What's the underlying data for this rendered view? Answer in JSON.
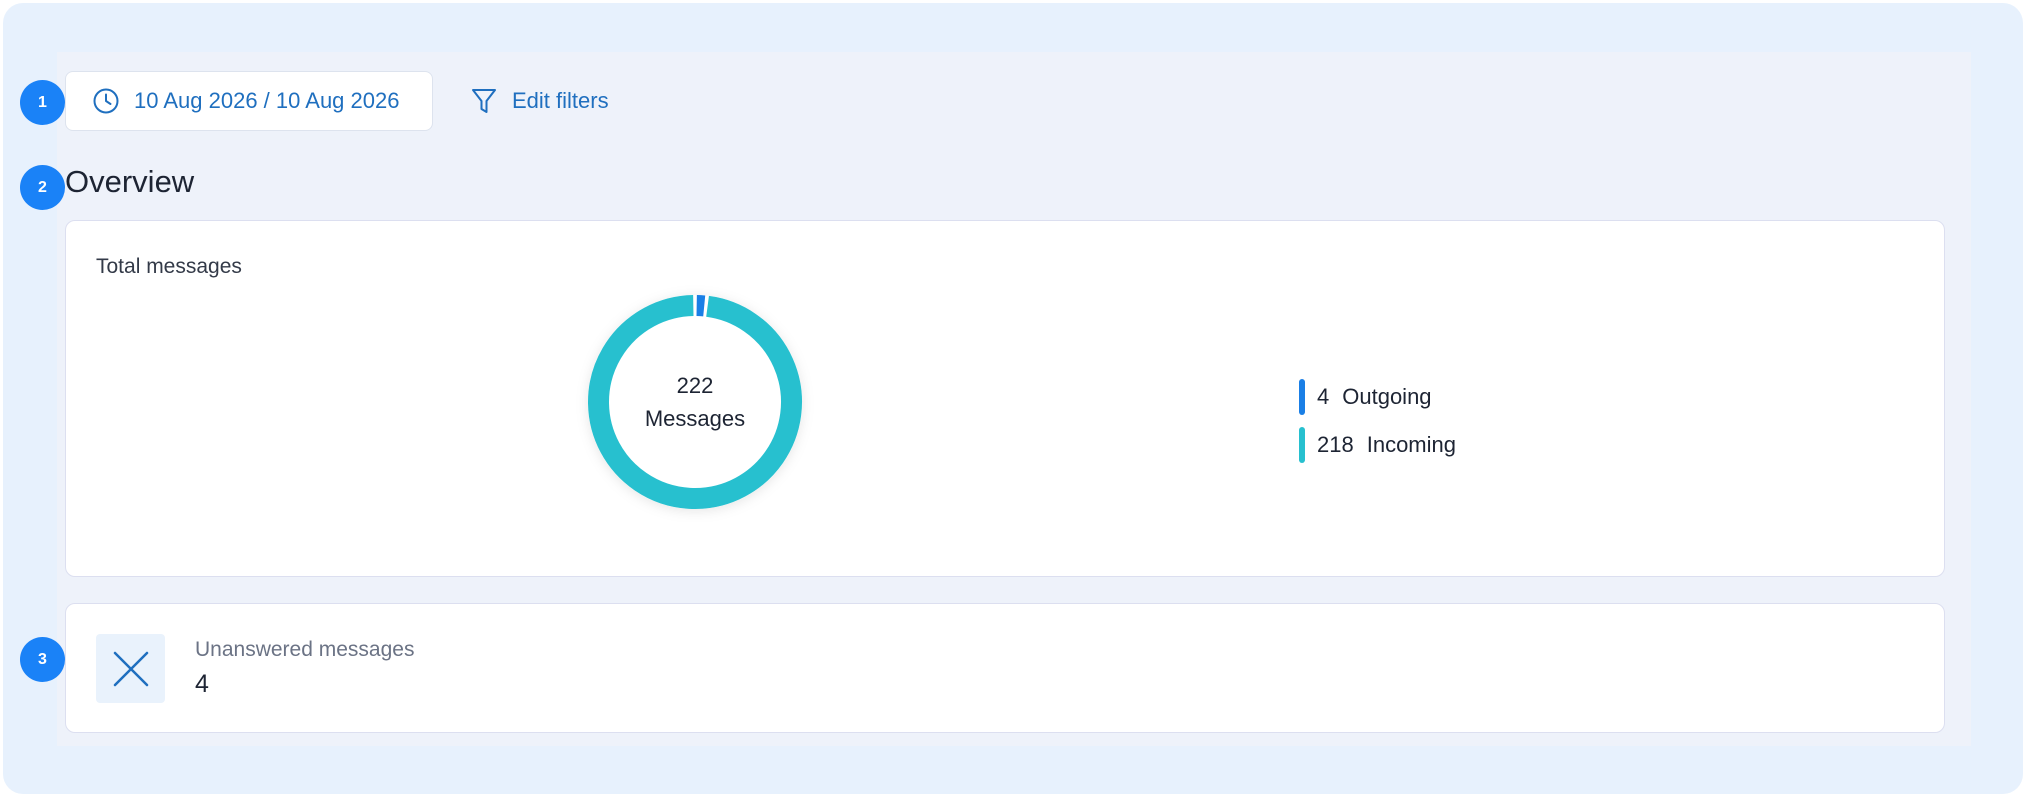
{
  "steps": [
    "1",
    "2",
    "3"
  ],
  "toolbar": {
    "date_range": "10 Aug 2026 / 10 Aug 2026",
    "edit_filters_label": "Edit filters",
    "date_icon": "clock-icon",
    "filter_icon": "funnel-icon"
  },
  "overview": {
    "title": "Overview",
    "total_card": {
      "title": "Total messages",
      "center_value": "222",
      "center_label": "Messages",
      "legend": [
        {
          "count": "4",
          "label": "Outgoing",
          "value": 4,
          "color": "#1a7fe6"
        },
        {
          "count": "218",
          "label": "Incoming",
          "value": 218,
          "color": "#27c0cf"
        }
      ]
    },
    "unanswered_card": {
      "icon": "close-icon",
      "label": "Unanswered messages",
      "value": "4"
    }
  },
  "colors": {
    "accent": "#1f6fbf",
    "step_badge": "#1a82f7",
    "frame_bg": "#e7f1fd",
    "panel_bg": "#eef2fa"
  }
}
